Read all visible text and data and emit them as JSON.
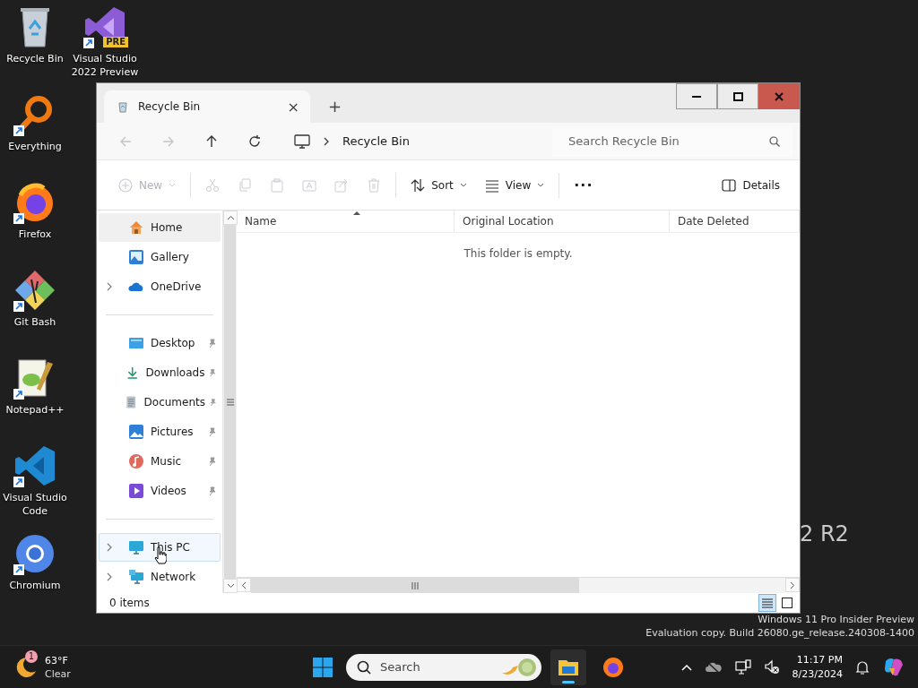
{
  "desktop_icons": [
    {
      "label": "Recycle Bin",
      "kind": "recycle-bin",
      "shortcut": false
    },
    {
      "label": "Visual Studio 2022 Preview",
      "kind": "visual-studio",
      "shortcut": true,
      "badge": "PRE"
    },
    {
      "label": "Everything",
      "kind": "everything",
      "shortcut": true
    },
    {
      "label": "Firefox",
      "kind": "firefox",
      "shortcut": true
    },
    {
      "label": "Git Bash",
      "kind": "git",
      "shortcut": true
    },
    {
      "label": "Notepad++",
      "kind": "notepad",
      "shortcut": true
    },
    {
      "label": "Visual Studio Code",
      "kind": "vscode",
      "shortcut": true
    },
    {
      "label": "Chromium",
      "kind": "chromium",
      "shortcut": true
    }
  ],
  "wallpaper_text": "2 R2",
  "window": {
    "tabs": [
      {
        "title": "Recycle Bin",
        "selected": true,
        "close": "×"
      }
    ],
    "new_tab": "+",
    "caption_buttons": [
      {
        "kind": "minimize"
      },
      {
        "kind": "maximize"
      },
      {
        "kind": "close"
      }
    ],
    "nav_buttons": [
      {
        "kind": "back",
        "disabled": true
      },
      {
        "kind": "forward",
        "disabled": true
      },
      {
        "kind": "up",
        "disabled": false
      },
      {
        "kind": "refresh",
        "disabled": false
      }
    ],
    "breadcrumb": [
      {
        "label": "Recycle Bin"
      }
    ],
    "search": {
      "placeholder": "Search Recycle Bin"
    },
    "toolbar": [
      {
        "kind": "new",
        "label": "New",
        "disabled": true,
        "dropdown": true
      },
      {
        "kind": "separator"
      },
      {
        "kind": "cut",
        "disabled": true,
        "dropdown": false
      },
      {
        "kind": "copy",
        "disabled": true,
        "dropdown": false
      },
      {
        "kind": "paste",
        "disabled": true,
        "dropdown": false
      },
      {
        "kind": "rename",
        "disabled": true,
        "dropdown": false
      },
      {
        "kind": "share",
        "disabled": true,
        "dropdown": false
      },
      {
        "kind": "delete",
        "disabled": true,
        "dropdown": false
      },
      {
        "kind": "separator"
      },
      {
        "kind": "sort",
        "label": "Sort",
        "disabled": false,
        "dropdown": true
      },
      {
        "kind": "view",
        "label": "View",
        "disabled": false,
        "dropdown": true
      },
      {
        "kind": "separator"
      },
      {
        "kind": "more",
        "label": "···",
        "disabled": false,
        "dropdown": false
      },
      {
        "kind": "spacer"
      },
      {
        "kind": "details",
        "label": "Details",
        "disabled": false,
        "dropdown": false
      }
    ],
    "sidebar": {
      "groups": [
        [
          {
            "label": "Home",
            "kind": "home",
            "expandable": false,
            "pinned": false,
            "selected": true,
            "hovered": false
          },
          {
            "label": "Gallery",
            "kind": "gallery",
            "expandable": false,
            "pinned": false,
            "selected": false,
            "hovered": false
          },
          {
            "label": "OneDrive",
            "kind": "onedrive",
            "expandable": true,
            "pinned": false,
            "selected": false,
            "hovered": false
          }
        ],
        [
          {
            "label": "Desktop",
            "kind": "desktop",
            "expandable": false,
            "pinned": true,
            "selected": false,
            "hovered": false
          },
          {
            "label": "Downloads",
            "kind": "downloads",
            "expandable": false,
            "pinned": true,
            "selected": false,
            "hovered": false
          },
          {
            "label": "Documents",
            "kind": "documents",
            "expandable": false,
            "pinned": true,
            "selected": false,
            "hovered": false
          },
          {
            "label": "Pictures",
            "kind": "pictures",
            "expandable": false,
            "pinned": true,
            "selected": false,
            "hovered": false
          },
          {
            "label": "Music",
            "kind": "music",
            "expandable": false,
            "pinned": true,
            "selected": false,
            "hovered": false
          },
          {
            "label": "Videos",
            "kind": "videos",
            "expandable": false,
            "pinned": true,
            "selected": false,
            "hovered": false
          }
        ],
        [
          {
            "label": "This PC",
            "kind": "pc",
            "expandable": true,
            "pinned": false,
            "selected": false,
            "hovered": true
          },
          {
            "label": "Network",
            "kind": "network",
            "expandable": true,
            "pinned": false,
            "selected": false,
            "hovered": false
          }
        ]
      ]
    },
    "columns": [
      {
        "label": "Name",
        "sorted": true
      },
      {
        "label": "Original Location",
        "sorted": false
      },
      {
        "label": "Date Deleted",
        "sorted": false
      }
    ],
    "empty_message": "This folder is empty.",
    "status": "0 items",
    "view_modes": [
      {
        "kind": "details",
        "selected": true
      },
      {
        "kind": "tiles",
        "selected": false
      }
    ]
  },
  "watermark": [
    "Windows 11 Pro Insider Preview",
    "Evaluation copy. Build 26080.ge_release.240308-1400"
  ],
  "taskbar": {
    "weather": {
      "temperature": "63°F",
      "condition": "Clear",
      "badge": "1"
    },
    "search": {
      "placeholder": "Search"
    },
    "apps": [
      {
        "kind": "explorer",
        "running": true
      },
      {
        "kind": "firefox",
        "running": false
      }
    ],
    "clock": {
      "time": "11:17 PM",
      "date": "8/23/2024"
    }
  }
}
